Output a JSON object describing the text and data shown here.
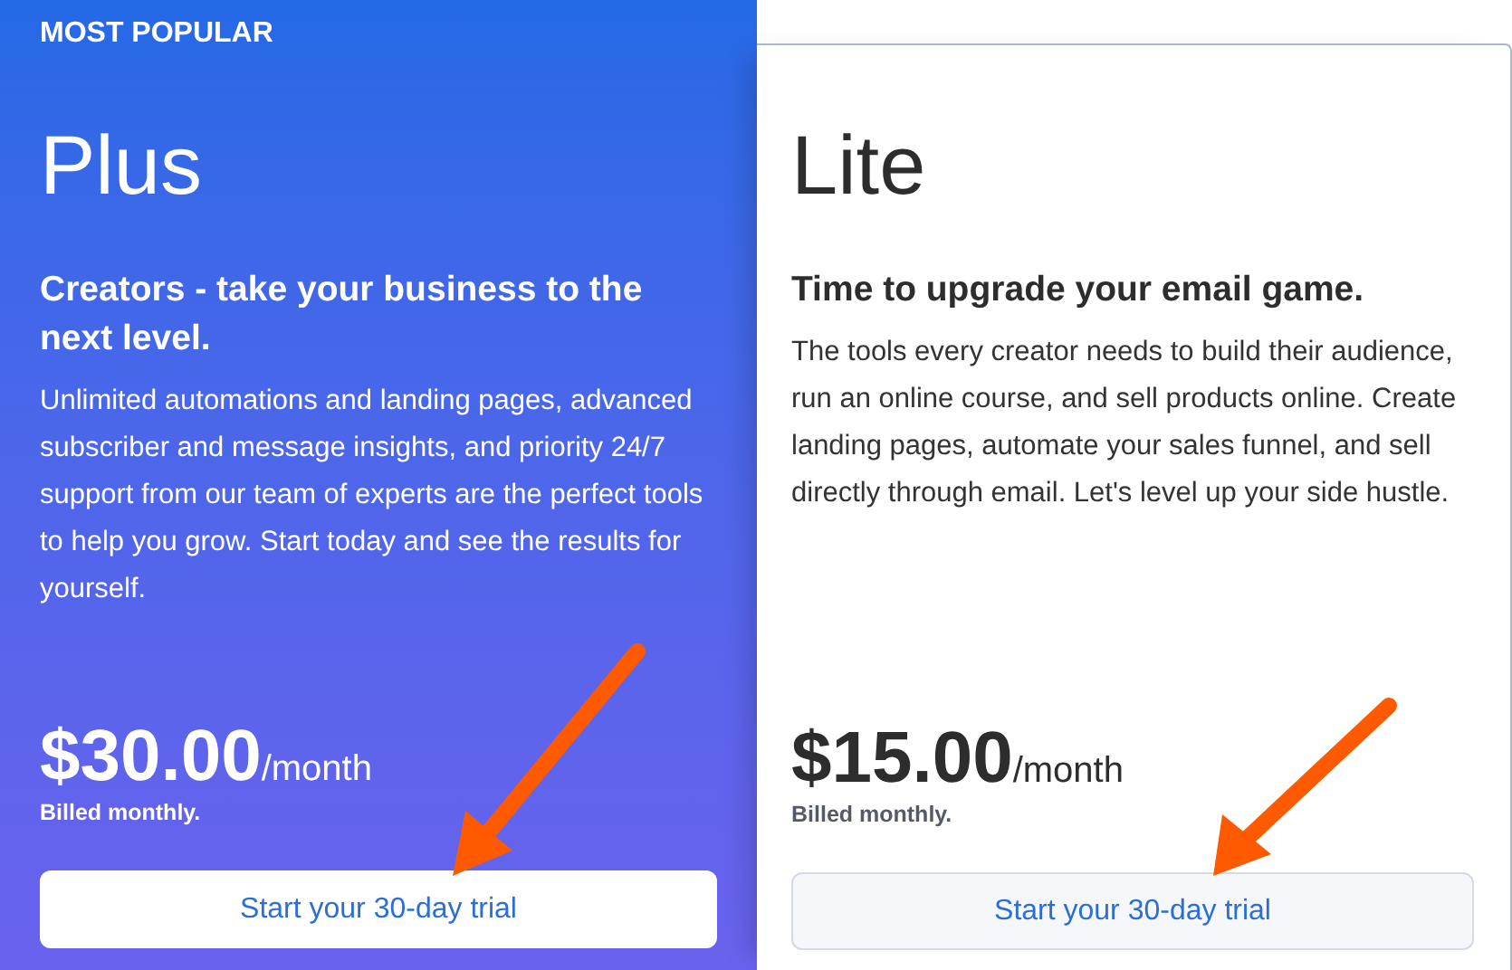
{
  "plans": [
    {
      "badge": "MOST POPULAR",
      "featured": true,
      "name": "Plus",
      "headline": "Creators - take your business to the next level.",
      "description": "Unlimited automations and landing pages, advanced subscriber and message insights, and priority 24/7 support from our team of experts are the perfect tools to help you grow. Start today and see the results for yourself.",
      "price": "$30.00",
      "period": "/month",
      "billing": "Billed monthly.",
      "button": "Start your 30-day trial"
    },
    {
      "featured": false,
      "name": "Lite",
      "headline": "Time to upgrade your email game.",
      "description": "The tools every creator needs to build their audience, run an online course, and sell products online. Create landing pages, automate your sales funnel, and sell directly through email. Let's level up your side hustle.",
      "price": "$15.00",
      "period": "/month",
      "billing": "Billed monthly.",
      "button": "Start your 30-day trial"
    }
  ]
}
